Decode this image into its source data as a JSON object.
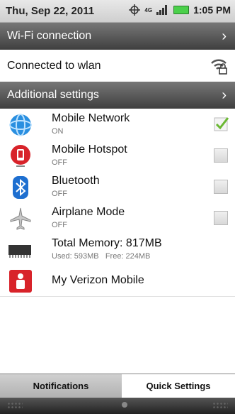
{
  "status_bar": {
    "date": "Thu, Sep 22, 2011",
    "time": "1:05 PM",
    "network_badge": "4G",
    "icons": [
      "gps-icon",
      "signal-icon",
      "battery-icon"
    ]
  },
  "sections": {
    "wifi_header": "Wi-Fi connection",
    "wifi_status": "Connected to wlan",
    "additional_header": "Additional settings"
  },
  "items": [
    {
      "title": "Mobile Network",
      "state": "ON",
      "checked": true,
      "icon": "globe-icon"
    },
    {
      "title": "Mobile Hotspot",
      "state": "OFF",
      "checked": false,
      "icon": "hotspot-icon"
    },
    {
      "title": "Bluetooth",
      "state": "OFF",
      "checked": false,
      "icon": "bluetooth-icon"
    },
    {
      "title": "Airplane Mode",
      "state": "OFF",
      "checked": false,
      "icon": "airplane-icon"
    }
  ],
  "memory": {
    "title": "Total Memory: 817MB",
    "detail": "Used: 593MB   Free: 224MB"
  },
  "verizon": {
    "title": "My Verizon Mobile"
  },
  "tabs": {
    "left": "Notifications",
    "right": "Quick Settings"
  },
  "colors": {
    "check": "#6ab832",
    "header": "#4a4a4a",
    "verizon_red": "#d8232a"
  }
}
